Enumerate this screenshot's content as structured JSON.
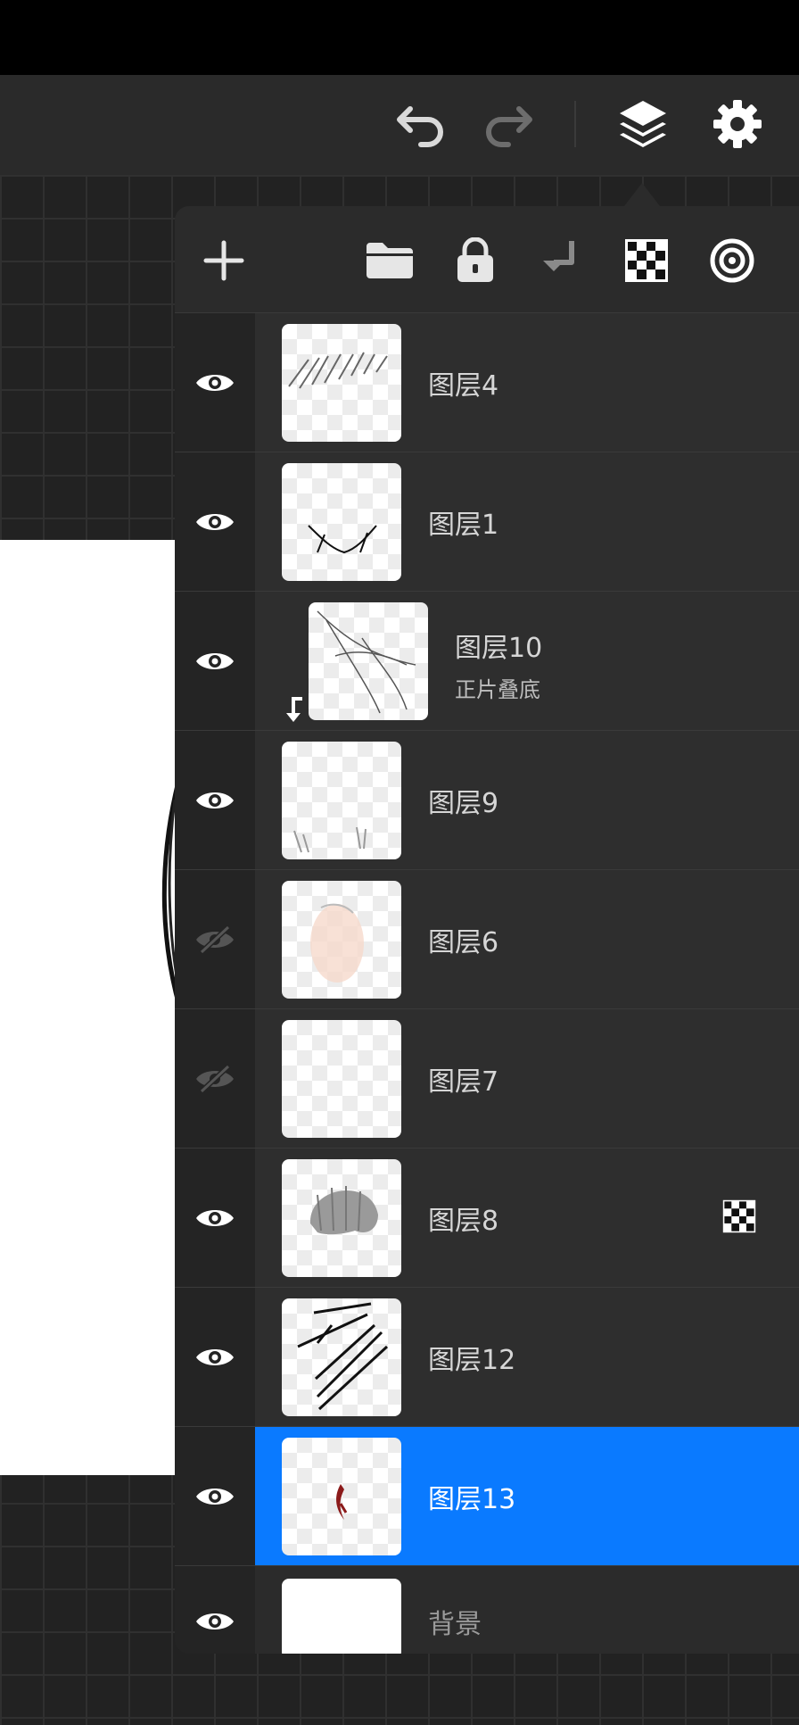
{
  "toolbar": {
    "undo_icon": "undo-arrow-icon",
    "redo_icon": "redo-arrow-icon",
    "layers_icon": "layers-stack-icon",
    "settings_icon": "gear-icon"
  },
  "layers_panel": {
    "header_icons": [
      "plus-icon",
      "folder-icon",
      "lock-icon",
      "merge-down-icon",
      "checkerboard-icon",
      "reference-target-icon"
    ],
    "accent_color": "#0a7aff",
    "layers": [
      {
        "name": "图层4",
        "visible": true,
        "thumb": "diagonal-hatch-sketch"
      },
      {
        "name": "图层1",
        "visible": true,
        "thumb": "collarbone-sketch"
      },
      {
        "name": "图层10",
        "blend": "正片叠底",
        "visible": true,
        "clipping": true,
        "thumb": "curve-lines-sketch"
      },
      {
        "name": "图层9",
        "visible": true,
        "thumb": "faint-marks"
      },
      {
        "name": "图层6",
        "visible": false,
        "thumb": "skin-tone-sketch"
      },
      {
        "name": "图层7",
        "visible": false,
        "thumb": "empty"
      },
      {
        "name": "图层8",
        "visible": true,
        "alpha_lock": true,
        "thumb": "hair-gray-sketch"
      },
      {
        "name": "图层12",
        "visible": true,
        "thumb": "black-strokes"
      },
      {
        "name": "图层13",
        "visible": true,
        "active": true,
        "thumb": "red-mark"
      },
      {
        "name": "背景",
        "visible": true,
        "background": true,
        "thumb": "white"
      }
    ]
  }
}
